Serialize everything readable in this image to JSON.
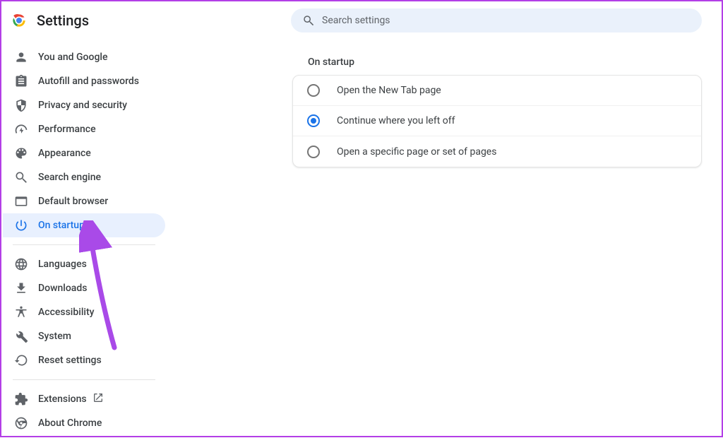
{
  "header": {
    "title": "Settings",
    "search_placeholder": "Search settings"
  },
  "sidebar": {
    "groups": [
      [
        "You and Google",
        "Autofill and passwords",
        "Privacy and security",
        "Performance",
        "Appearance",
        "Search engine",
        "Default browser",
        "On startup"
      ],
      [
        "Languages",
        "Downloads",
        "Accessibility",
        "System",
        "Reset settings"
      ],
      [
        "Extensions",
        "About Chrome"
      ]
    ],
    "active": "On startup"
  },
  "main": {
    "section_title": "On startup",
    "options": [
      {
        "label": "Open the New Tab page",
        "selected": false
      },
      {
        "label": "Continue where you left off",
        "selected": true
      },
      {
        "label": "Open a specific page or set of pages",
        "selected": false
      }
    ]
  }
}
